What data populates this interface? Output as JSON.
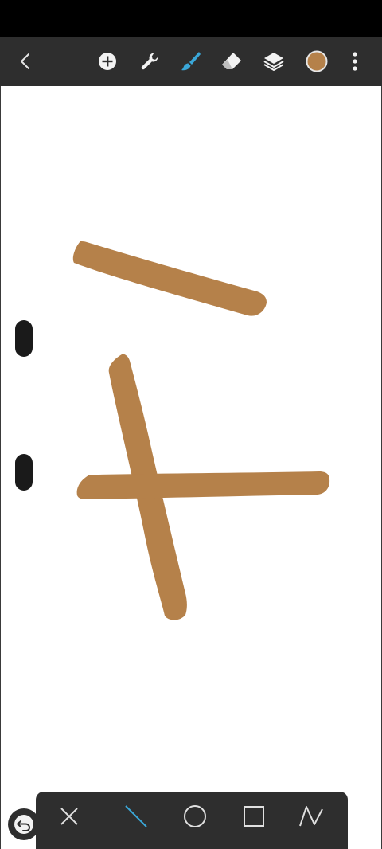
{
  "toolbar": {
    "icons": {
      "back": "chevron-left-icon",
      "add": "plus-circle-icon",
      "settings": "wrench-icon",
      "brush": "brush-icon",
      "eraser": "eraser-icon",
      "layers": "layers-icon",
      "color": "color-swatch",
      "more": "more-vertical-icon"
    },
    "active_tool": "brush",
    "active_color": "#b5814a",
    "accent_color": "#3aa7d8"
  },
  "canvas": {
    "background": "#ffffff",
    "stroke_color": "#b5814a"
  },
  "shape_tools": {
    "items": [
      "close",
      "line",
      "circle",
      "rectangle",
      "polyline"
    ],
    "selected": "line"
  },
  "undo": {
    "icon": "undo-icon"
  }
}
